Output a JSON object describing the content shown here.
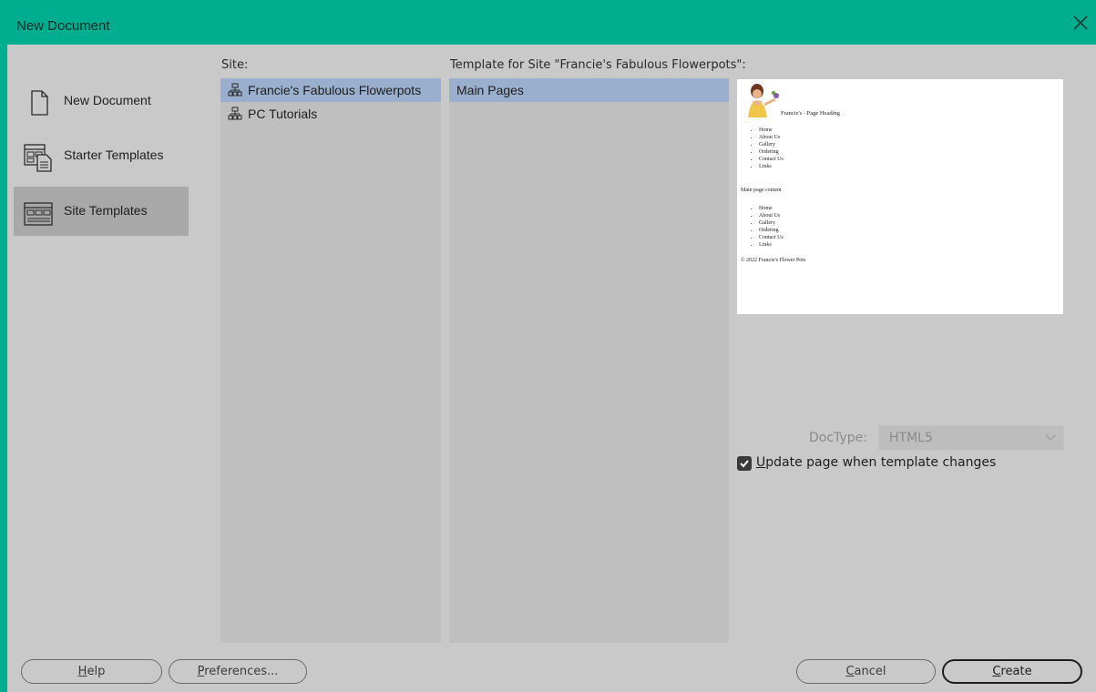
{
  "window": {
    "title": "New Document",
    "close_icon": "close-icon"
  },
  "nav": [
    {
      "label": "New Document",
      "icon": "document-icon",
      "selected": false
    },
    {
      "label": "Starter Templates",
      "icon": "starter-templates-icon",
      "selected": false
    },
    {
      "label": "Site Templates",
      "icon": "site-templates-icon",
      "selected": true
    }
  ],
  "site_column": {
    "label": "Site:",
    "items": [
      {
        "label": "Francie's Fabulous Flowerpots",
        "icon": "site-icon",
        "selected": true
      },
      {
        "label": "PC Tutorials",
        "icon": "site-icon",
        "selected": false
      }
    ]
  },
  "template_column": {
    "label": "Template for Site \"Francie's Fabulous Flowerpots\":",
    "items": [
      {
        "label": "Main Pages",
        "selected": true
      }
    ]
  },
  "preview": {
    "heading": "Francie's - Page Heading",
    "nav_links": [
      "Home",
      "About Us",
      "Gallery",
      "Ordering",
      "Contact Us",
      "Links"
    ],
    "content_text": "Main page content",
    "footer_links": [
      "Home",
      "About Us",
      "Gallery",
      "Ordering",
      "Contact Us",
      "Links"
    ],
    "copyright": "© 2022 Francie's Flower Pots"
  },
  "doctype": {
    "label": "DocType:",
    "value": "HTML5",
    "enabled": false
  },
  "update_option": {
    "label_first": "U",
    "label_rest": "pdate page when template changes",
    "checked": true
  },
  "buttons": {
    "help": {
      "accel": "H",
      "rest": "elp"
    },
    "preferences": {
      "accel": "P",
      "rest": "references..."
    },
    "cancel": {
      "accel": "C",
      "rest": "ancel"
    },
    "create": {
      "accel": "C",
      "rest": "reate"
    }
  },
  "colors": {
    "title_bar": "#00ad8f",
    "selection": "#9aaecd",
    "nav_selected": "#a8a8a8"
  }
}
